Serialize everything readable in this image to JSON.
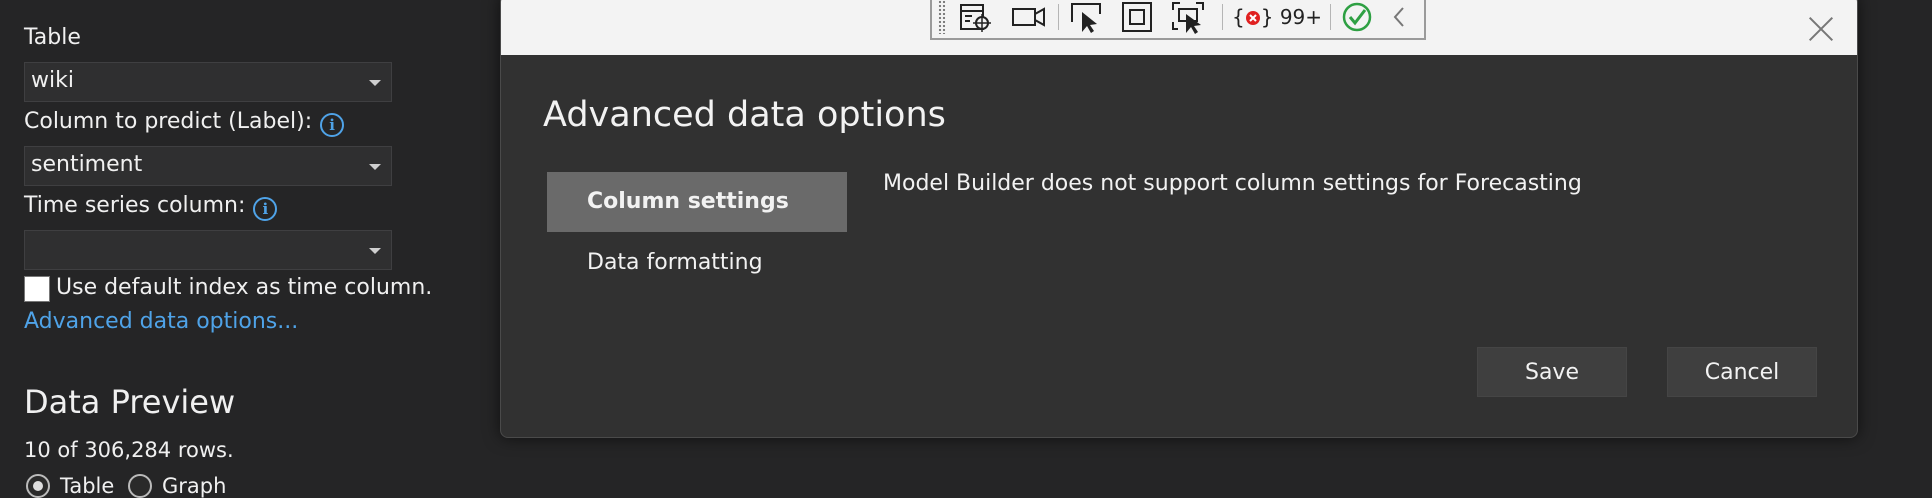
{
  "form": {
    "table_label": "Table",
    "table_value": "wiki",
    "column_label": "Column to predict (Label):",
    "column_value": "sentiment",
    "timeseries_label": "Time series column:",
    "timeseries_value": "",
    "default_index_label": "Use default index as time column.",
    "advanced_link": "Advanced data options...",
    "info_glyph": "i"
  },
  "preview": {
    "title": "Data Preview",
    "rows_text": "10 of 306,284 rows.",
    "radio_table": "Table",
    "radio_graph": "Graph"
  },
  "dialog": {
    "title": "Advanced data options",
    "nav_column_settings": "Column settings",
    "nav_data_formatting": "Data formatting",
    "message": "Model Builder does not support column settings for Forecasting",
    "save_label": "Save",
    "cancel_label": "Cancel"
  },
  "toolbar": {
    "exceptions_count": "99+",
    "brace_open": "{",
    "brace_close": "}"
  },
  "colors": {
    "background": "#252526",
    "link": "#4fa3e8",
    "selected_nav": "#6a6a6a",
    "success": "#2ea043",
    "error": "#e02020"
  }
}
